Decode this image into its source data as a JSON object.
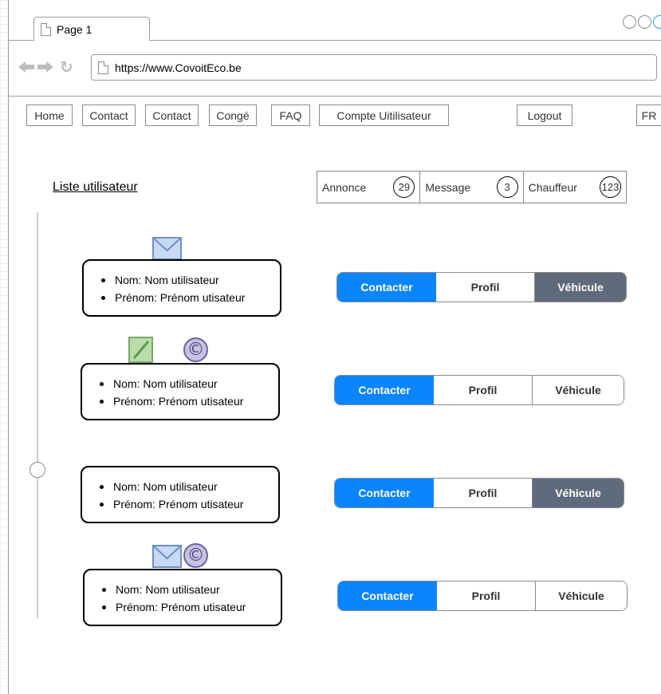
{
  "browser": {
    "tab_title": "Page 1",
    "url": "https://www.CovoitEco.be"
  },
  "nav": {
    "home": "Home",
    "contact1": "Contact",
    "contact2": "Contact",
    "conge": "Congé",
    "faq": "FAQ",
    "compte": "Compte Uitilisateur",
    "logout": "Logout",
    "lang": "FR"
  },
  "page": {
    "list_title": "Liste  utilisateur"
  },
  "stats": [
    {
      "label": "Annonce",
      "count": "29"
    },
    {
      "label": "Message",
      "count": "3"
    },
    {
      "label": "Chauffeur",
      "count": "123"
    }
  ],
  "users": [
    {
      "nom": "Nom: Nom utilisateur",
      "prenom": "Prénom: Prénom utisateur"
    },
    {
      "nom": "Nom: Nom utilisateur",
      "prenom": "Prénom: Prénom utisateur"
    },
    {
      "nom": "Nom: Nom utilisateur",
      "prenom": "Prénom: Prénom utisateur"
    },
    {
      "nom": "Nom: Nom utilisateur",
      "prenom": "Prénom: Prénom utisateur"
    }
  ],
  "actions": {
    "contact": "Contacter",
    "profil": "Profil",
    "vehicule": "Véhicule"
  },
  "icons": {
    "mail": "mail-icon",
    "edit": "edit-icon",
    "copyright": "copyright-icon",
    "copyright_glyph": "©"
  },
  "colors": {
    "primary": "#0a84ff",
    "vehicle_active": "#5f6b7a"
  }
}
